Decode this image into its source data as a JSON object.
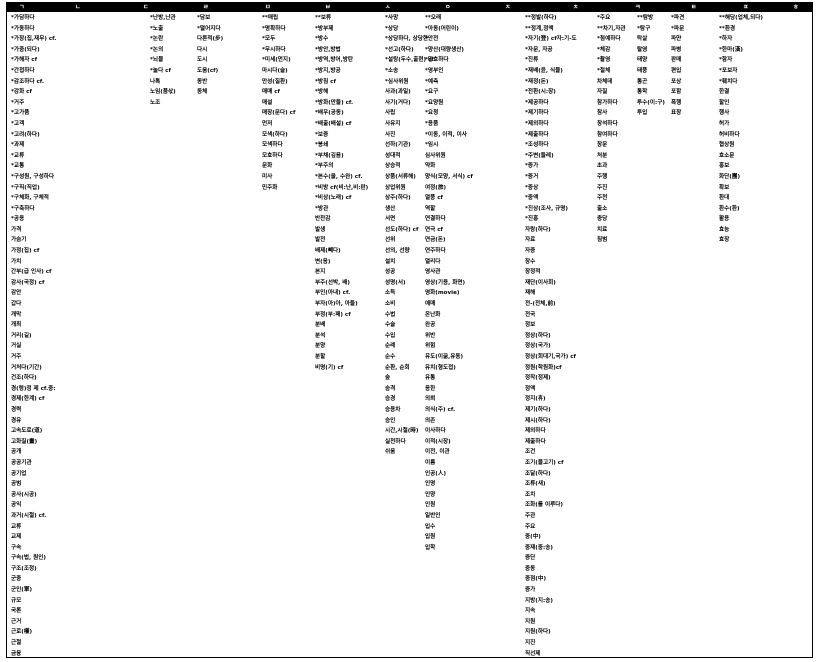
{
  "header": [
    "ㄱ",
    "ㄴ",
    "ㄷ",
    "ㄹ",
    "ㅁ",
    "ㅂ",
    "ㅅ",
    "ㅇ",
    "ㅈ",
    "ㅊ",
    "ㅋ",
    "ㅌ",
    "ㅍ",
    "ㅎ"
  ],
  "columns": [
    [
      "*가담하다",
      "*가동하다",
      "*가장(집,재무) cf.",
      "*가중(되다)",
      "*가해자 cf",
      "*간접하다",
      "*감조하다 cf.",
      "*강화 cf",
      "*거주",
      "*고가품",
      "*고객",
      "*고려(하다)",
      "*과제",
      "*교류",
      "*교통",
      "*구성원, 구성하다",
      "*구직(직업)",
      "*구체화, 구체적",
      "*구축하다",
      "*공용",
      "가격",
      "가슴기",
      "가정(집) cf",
      "가치",
      "간부(급 인사) cf",
      "감사(국정) cf",
      "감안",
      "갑다",
      "개막",
      "개최",
      "거리(길)",
      "거실",
      "거주",
      "거처다(기간)",
      "건조(하다)",
      "경(령)정 제 cf.중:",
      "경제(한계) cf",
      "경력",
      "경유",
      "고속도로(道)",
      "고화질(畫)",
      "공개",
      "공공기관",
      "공기업",
      "공범",
      "공사(시공)",
      "공익",
      "과거(시절) cf.",
      "교류",
      "교제",
      "구속",
      "구속(법, 원인)",
      "구조(조정)",
      "군중",
      "군인(軍)",
      "규모",
      "국론",
      "근거",
      "근로(權)",
      "근절",
      "금융",
      "기념",
      "기여하다",
      "기증"
    ],
    [
      "*난방,난관",
      "*노출",
      "*논란",
      "*논의",
      "*뇌물",
      "*눌다 cf",
      "나톡",
      "노임(품삯)",
      "노조"
    ],
    [
      "*담보",
      "*떨어지다",
      "다른적(步)",
      "다시",
      "도시",
      "도움(cf)",
      "동반",
      "동체"
    ],
    [
      "**매립",
      "*명확하다",
      "*모두",
      "*무시하다",
      "*미세(먼지)",
      "마시다(술)",
      "만성(질환)",
      "매매 cf",
      "매설",
      "매장(문다) cf",
      "먼저",
      "모색(하다)",
      "모색하다",
      "모호하다",
      "문화",
      "미사",
      "민주화"
    ],
    [
      "**보류",
      "*방부제",
      "*방수",
      "*방안,방법",
      "*방역,방어,방탄",
      "*방지,방공",
      "*방침 cf",
      "*방해",
      "*방화(만들) cf.",
      "*배우(공동)",
      "*배출(배설) cf",
      "*보증",
      "*봉쇄",
      "*부채(깊음)",
      "*부주의",
      "*본수(율, 수완) cf.",
      "*비방 cf(비:난,비:판)",
      "*비상(노래) cf",
      "*방관",
      "반찬감",
      "발생",
      "발전",
      "배제(빼다)",
      "변(응)",
      "본지",
      "부주(선박, 배)",
      "부인(아내) cf.",
      "부자(아)아, 아들)",
      "부정(부:패) cf",
      "분배",
      "분석",
      "분양",
      "분할",
      "비명(기) cf"
    ],
    [
      "*사망",
      "*상당",
      "*상당하다, 상당한",
      "*선고(하다)",
      "*설탕(두수,출현) cf.",
      "*소송",
      "*심사위원",
      "사과(과일)",
      "사기(거다)",
      "사립",
      "사유지",
      "사진",
      "선하(기관)",
      "성대적",
      "상승적",
      "상품(서류해)",
      "상업위원",
      "상주(하다)",
      "생산",
      "서면",
      "선도(하다) cf",
      "선위",
      "선의, 선량",
      "설치",
      "성공",
      "성명(서)",
      "소득",
      "소비",
      "수법",
      "수술",
      "수입",
      "순례",
      "순수",
      "순환, 순회",
      "숲",
      "숭격",
      "승경",
      "승용차",
      "승인",
      "시간,시절(時)",
      "실천하다",
      "쉬움"
    ],
    [
      "**오래",
      "*아동(어린이)",
      "*안전",
      "*양산(대량생산)",
      "*양호하다",
      "*영부인",
      "*예측",
      "*요구",
      "*요양원",
      "*요청",
      "*용품",
      "*이동, 이적, 이사",
      "*임시",
      "심사위원",
      "약화",
      "양식(모양, 서식) cf",
      "여정(旅)",
      "열풍 cf",
      "역할",
      "연결하다",
      "연극 cf",
      "연금(돈)",
      "연주하다",
      "열리다",
      "영사관",
      "영상(기용, 화면)",
      "영화(movie)",
      "예매",
      "온난화",
      "완공",
      "위반",
      "위험",
      "유도(이끎,유동)",
      "유치(형도접)",
      "유통",
      "응한",
      "의뢰",
      "의식(주) cf.",
      "의존",
      "이사하다",
      "이적(시장)",
      "이전, 이관",
      "이름",
      "인공(人)",
      "인명",
      "인양",
      "인원",
      "일반인",
      "입수",
      "입원",
      "입학"
    ],
    [
      "**정발(하다)",
      "**정계,정액",
      "*자기(登) cf자:기-도",
      "*자문, 자공",
      "*진류",
      "*재배(윤, 식물)",
      "*재정(돈)",
      "*전환(시:장)",
      "*제공하다",
      "*제기하다",
      "*제외하다",
      "*제출하다",
      "*조성하다",
      "*주변(둘레)",
      "*증가",
      "*증거",
      "*중상",
      "*중액",
      "*진상(조사, 규명)",
      "*진흥",
      "자랑(하다)",
      "자료",
      "자증",
      "장수",
      "장정적",
      "재단(이사회)",
      "재해",
      "전-(전체,前)",
      "전국",
      "정보",
      "정상(하다)",
      "정상(국가)",
      "정상(회대기,국가) cf",
      "정원(학원화)cf",
      "정착(정제)",
      "정액",
      "정지(휴)",
      "제기(하다)",
      "제시(하다)",
      "제외하다",
      "제출하다",
      "조건",
      "조기(물고기) cf",
      "조달(하다)",
      "조류(새)",
      "조치",
      "조화(를 이루다)",
      "주관",
      "주요",
      "중(中)",
      "중재(중:송)",
      "증단",
      "중동",
      "중점(中)",
      "증가",
      "지방(지:송)",
      "지속",
      "지원",
      "지원(하다)",
      "지진",
      "직선제"
    ],
    [
      "*주요",
      "**차기,자관",
      "*첨예하다",
      "*체감",
      "*촬영",
      "*철체",
      "차체데",
      "자질",
      "참가하다",
      "참사",
      "창석하다",
      "참여하다",
      "창문",
      "처분",
      "초과",
      "주행",
      "주진",
      "주천",
      "출소",
      "충당",
      "치료",
      "침범"
    ],
    [],
    [
      "**탐방",
      "*탐구",
      "탁살",
      "탈영",
      "태양",
      "태풍",
      "통곤",
      "통학",
      "투수(이:구)",
      "투입"
    ],
    [
      "*파견",
      "*파문",
      "파먄",
      "파병",
      "판매",
      "편입",
      "포상",
      "포함",
      "폭행",
      "표창"
    ],
    [
      "**해당(업체,되다)",
      "**환경",
      "*하자",
      "*한마(漢)",
      "*함자",
      "*포보자",
      "*훼치다",
      "한결",
      "할인",
      "행사",
      "허가",
      "허비하다",
      "협상원",
      "호소문",
      "홍보",
      "화단(團)",
      "확보",
      "환대",
      "환수(환)",
      "활용",
      "효능",
      "효장"
    ]
  ]
}
